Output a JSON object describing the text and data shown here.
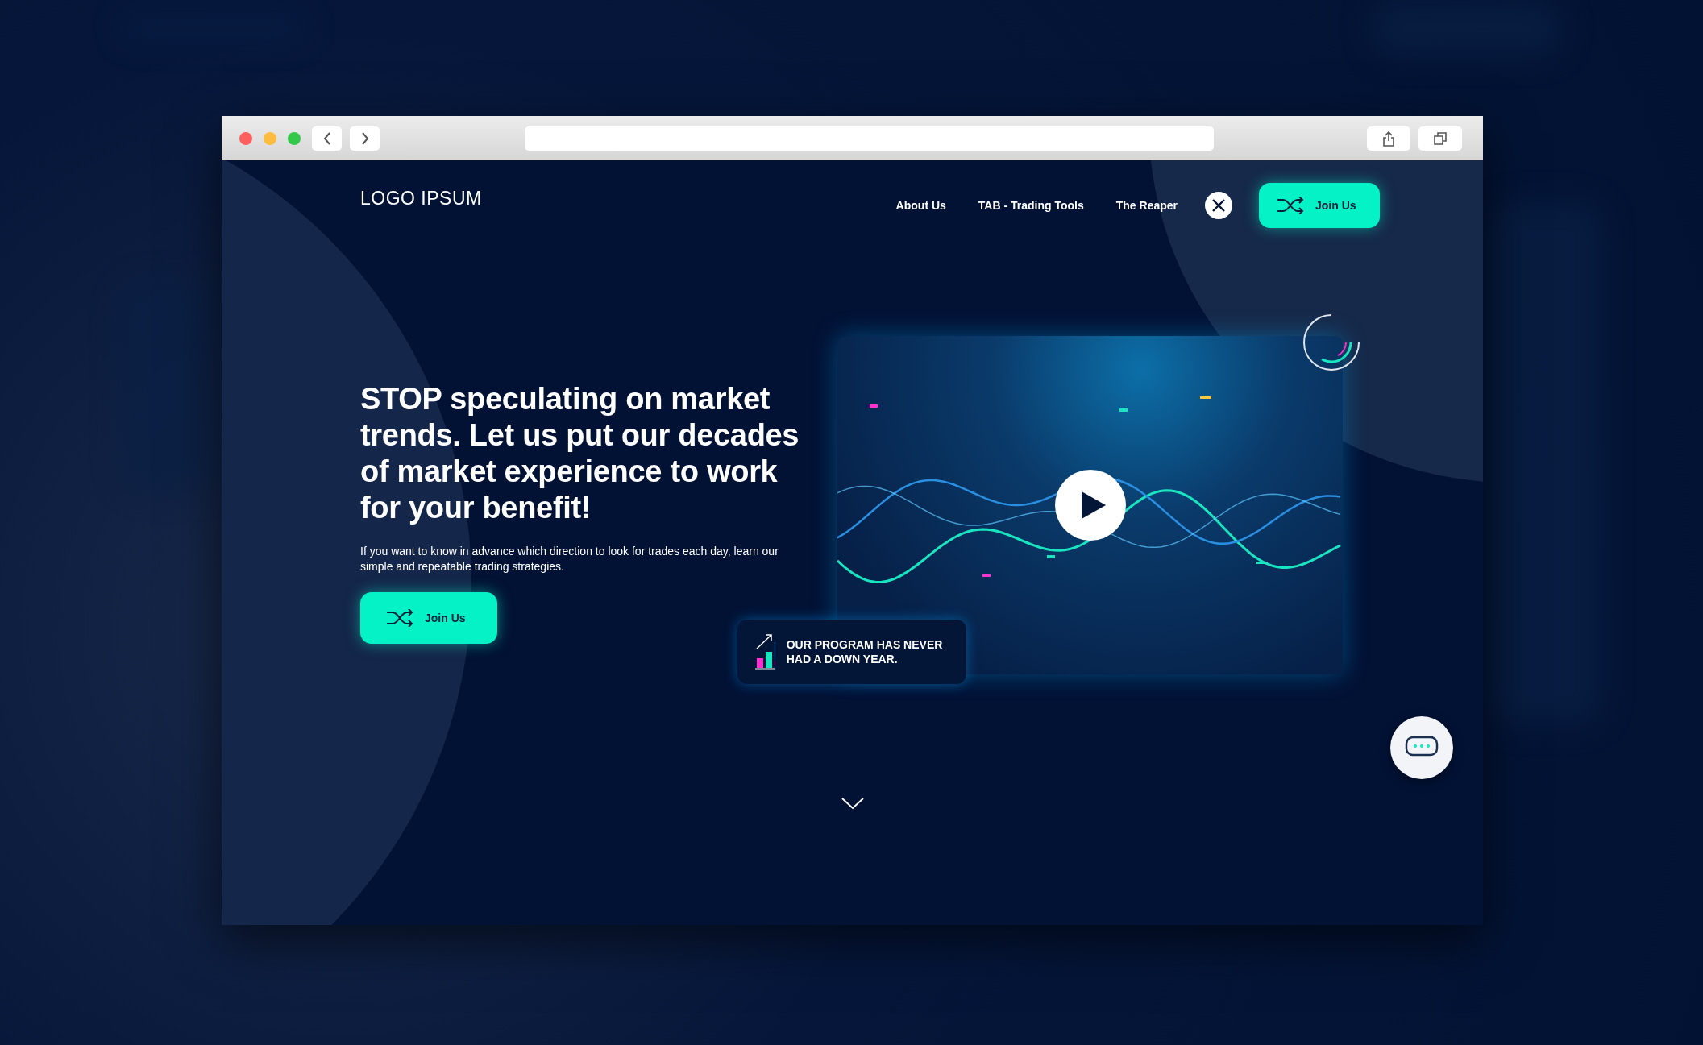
{
  "logo": "LOGO IPSUM",
  "nav": {
    "links": [
      "About Us",
      "TAB - Trading Tools",
      "The Reaper"
    ],
    "cta": "Join Us"
  },
  "hero": {
    "headline": "STOP speculating on market trends. Let us put our decades of market experience to work for your benefit!",
    "text": "If you want to know in advance which direction to look for trades each day, learn our simple and repeatable trading strategies.",
    "button": "Join Us"
  },
  "badge": {
    "text": "OUR PROGRAM HAS NEVER HAD A DOWN YEAR."
  }
}
